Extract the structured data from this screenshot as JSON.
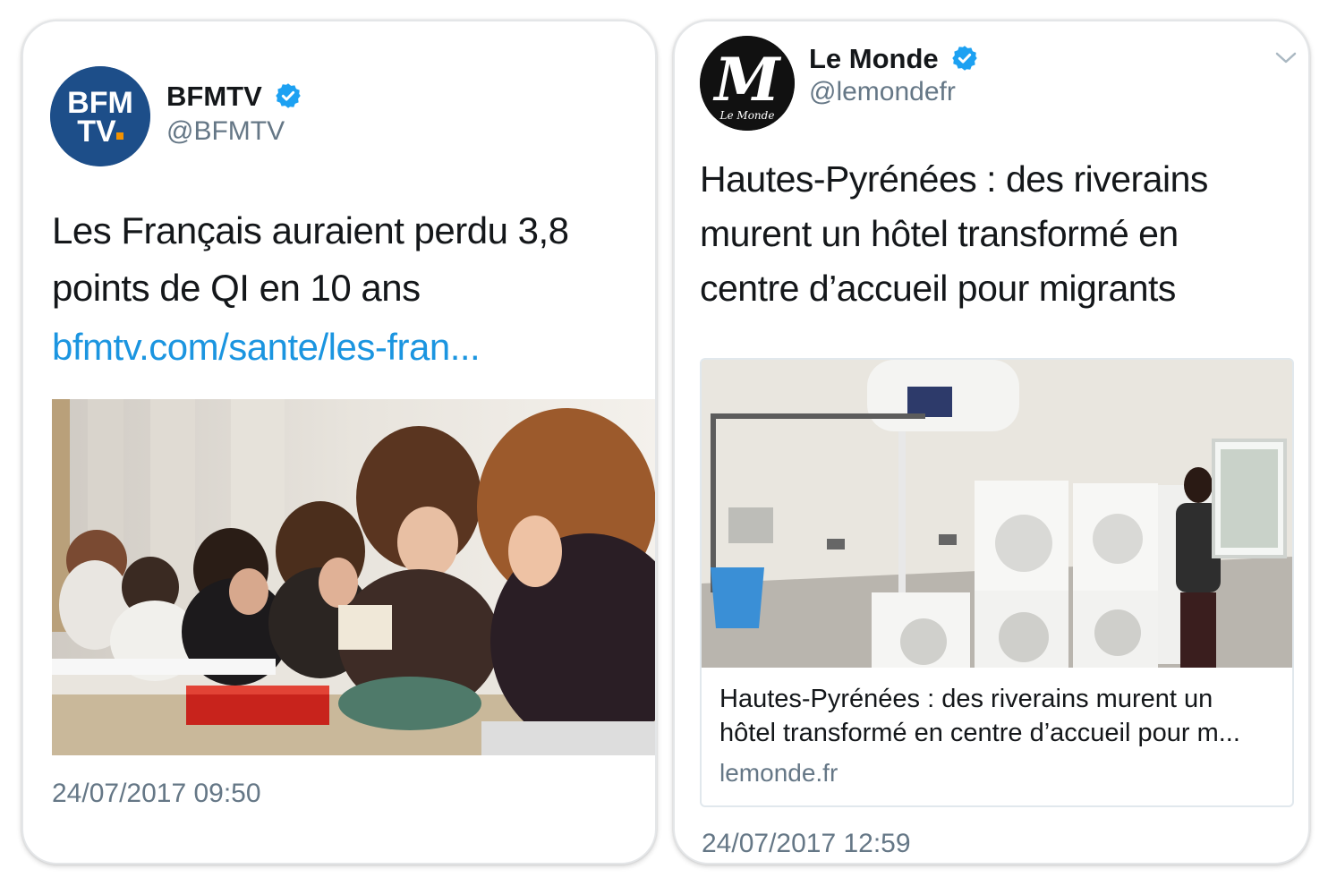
{
  "tweets": [
    {
      "avatar": {
        "logo_line1": "BFM",
        "logo_line2": "TV.",
        "color": "#1d4e89",
        "accent": "#f39200"
      },
      "name": "BFMTV",
      "handle": "@BFMTV",
      "text_line1": "Les Français auraient perdu 3,8",
      "text_line2": "points de QI en 10 ans",
      "link": "bfmtv.com/sante/les-fran...",
      "image": "classroom-students-photo",
      "timestamp": "24/07/2017 09:50"
    },
    {
      "avatar": {
        "logo_main": "M",
        "logo_sub": "Le Monde",
        "color": "#111111"
      },
      "name": "Le Monde",
      "handle": "@lemondefr",
      "text_line1": "Hautes-Pyrénées : des riverains",
      "text_line2": "murent un hôtel transformé en",
      "text_line3": "centre d’accueil pour migrants",
      "image": "laundry-room-photo",
      "card": {
        "title_line1": "Hautes-Pyrénées : des riverains murent un",
        "title_line2": "hôtel transformé en centre d’accueil pour m...",
        "domain": "lemonde.fr"
      },
      "timestamp": "24/07/2017 12:59"
    }
  ],
  "colors": {
    "verified": "#1da1f2",
    "link": "#1b95e0",
    "secondary_text": "#657786"
  }
}
